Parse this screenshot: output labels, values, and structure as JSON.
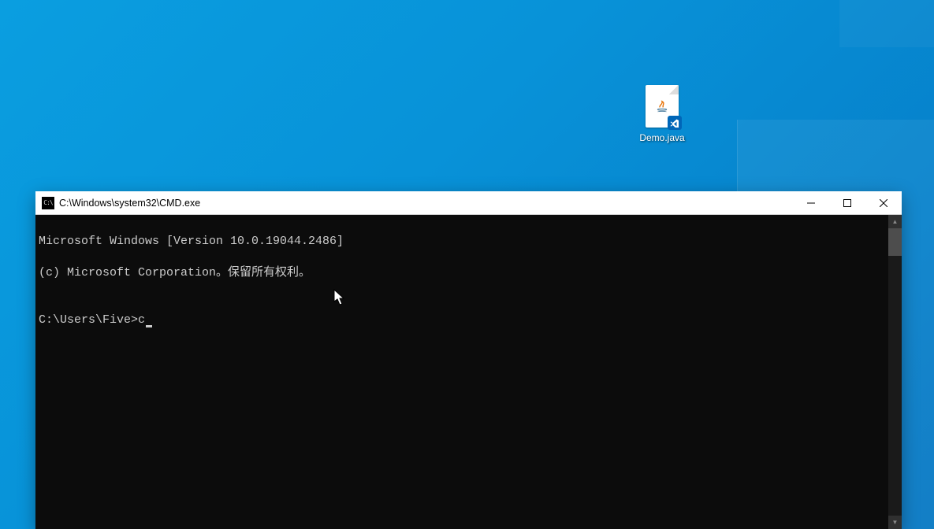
{
  "desktop": {
    "icons": [
      {
        "label": "Demo.java"
      }
    ]
  },
  "cmd": {
    "title": "C:\\Windows\\system32\\CMD.exe",
    "lines": {
      "l1": "Microsoft Windows [Version 10.0.19044.2486]",
      "l2": "(c) Microsoft Corporation。保留所有权利。",
      "blank": "",
      "prompt": "C:\\Users\\Five>",
      "typed": "c"
    }
  }
}
